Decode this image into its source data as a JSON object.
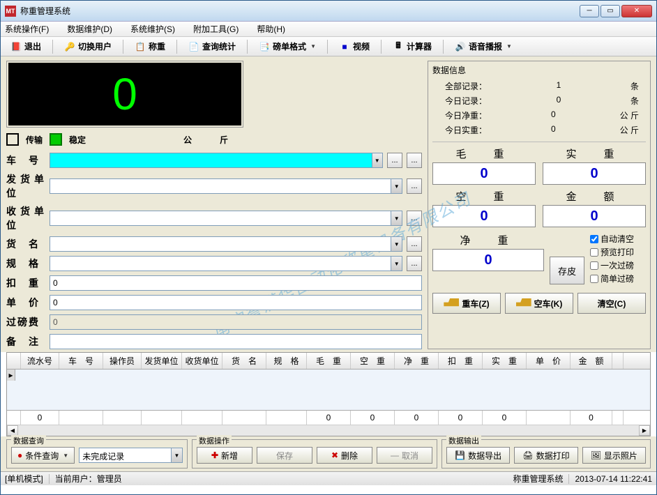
{
  "titlebar": {
    "app_name": "称重管理系统"
  },
  "menubar": {
    "items": [
      "系统操作(F)",
      "数据维护(D)",
      "系统维护(S)",
      "附加工具(G)",
      "帮助(H)"
    ]
  },
  "toolbar": {
    "exit": "退出",
    "switch_user": "切换用户",
    "weigh": "称重",
    "query_stat": "查询统计",
    "ticket_format": "磅单格式",
    "video": "视频",
    "calculator": "计算器",
    "voice": "语音播报"
  },
  "led": {
    "value": "0",
    "transmit": "传输",
    "stable": "稳定",
    "unit": "公　斤"
  },
  "form": {
    "labels": {
      "vehicle": "车　号",
      "sender": "发货单位",
      "receiver": "收货单位",
      "goods": "货　名",
      "spec": "规　格",
      "deduct": "扣　重",
      "price": "单　价",
      "fee": "过磅费",
      "remark": "备　注"
    },
    "values": {
      "deduct": "0",
      "price": "0",
      "fee": "0"
    }
  },
  "info": {
    "title": "数据信息",
    "rows": [
      {
        "label": "全部记录：",
        "val": "1",
        "unit": "条"
      },
      {
        "label": "今日记录：",
        "val": "0",
        "unit": "条"
      },
      {
        "label": "今日净重：",
        "val": "0",
        "unit": "公 斤"
      },
      {
        "label": "今日实重：",
        "val": "0",
        "unit": "公 斤"
      }
    ]
  },
  "weights": {
    "gross": {
      "label": "毛　重",
      "val": "0"
    },
    "actual": {
      "label": "实　重",
      "val": "0"
    },
    "tare": {
      "label": "空　重",
      "val": "0"
    },
    "amount": {
      "label": "金　额",
      "val": "0"
    },
    "net": {
      "label": "净　重",
      "val": "0"
    },
    "save_tare": "存皮",
    "checks": {
      "auto_clear": "自动清空",
      "preview": "预览打印",
      "once": "一次过磅",
      "simple": "简单过磅"
    },
    "heavy": "重车(Z)",
    "empty": "空车(K)",
    "clear": "清空(C)"
  },
  "grid": {
    "headers": [
      "",
      "流水号",
      "车　号",
      "操作员",
      "发货单位",
      "收货单位",
      "货　名",
      "规　格",
      "毛　重",
      "空　重",
      "净　重",
      "扣　重",
      "实　重",
      "单　价",
      "金　额",
      ""
    ],
    "footer": [
      "",
      "0",
      "",
      "",
      "",
      "",
      "",
      "",
      "0",
      "0",
      "0",
      "0",
      "0",
      "",
      "0",
      ""
    ]
  },
  "bottom": {
    "query": {
      "title": "数据查询",
      "cond": "条件查询",
      "incomplete": "未完成记录"
    },
    "ops": {
      "title": "数据操作",
      "add": "新增",
      "save": "保存",
      "del": "删除",
      "cancel": "取消"
    },
    "out": {
      "title": "数据输出",
      "export": "数据导出",
      "print": "数据打印",
      "photo": "显示照片"
    }
  },
  "statusbar": {
    "mode": "[单机模式]",
    "user_label": "当前用户：",
    "user": "管理员",
    "sys": "称重管理系统",
    "time": "2013-07-14 11:22:41"
  },
  "watermark": "南宁誉满华自动化称重设备有限公司"
}
